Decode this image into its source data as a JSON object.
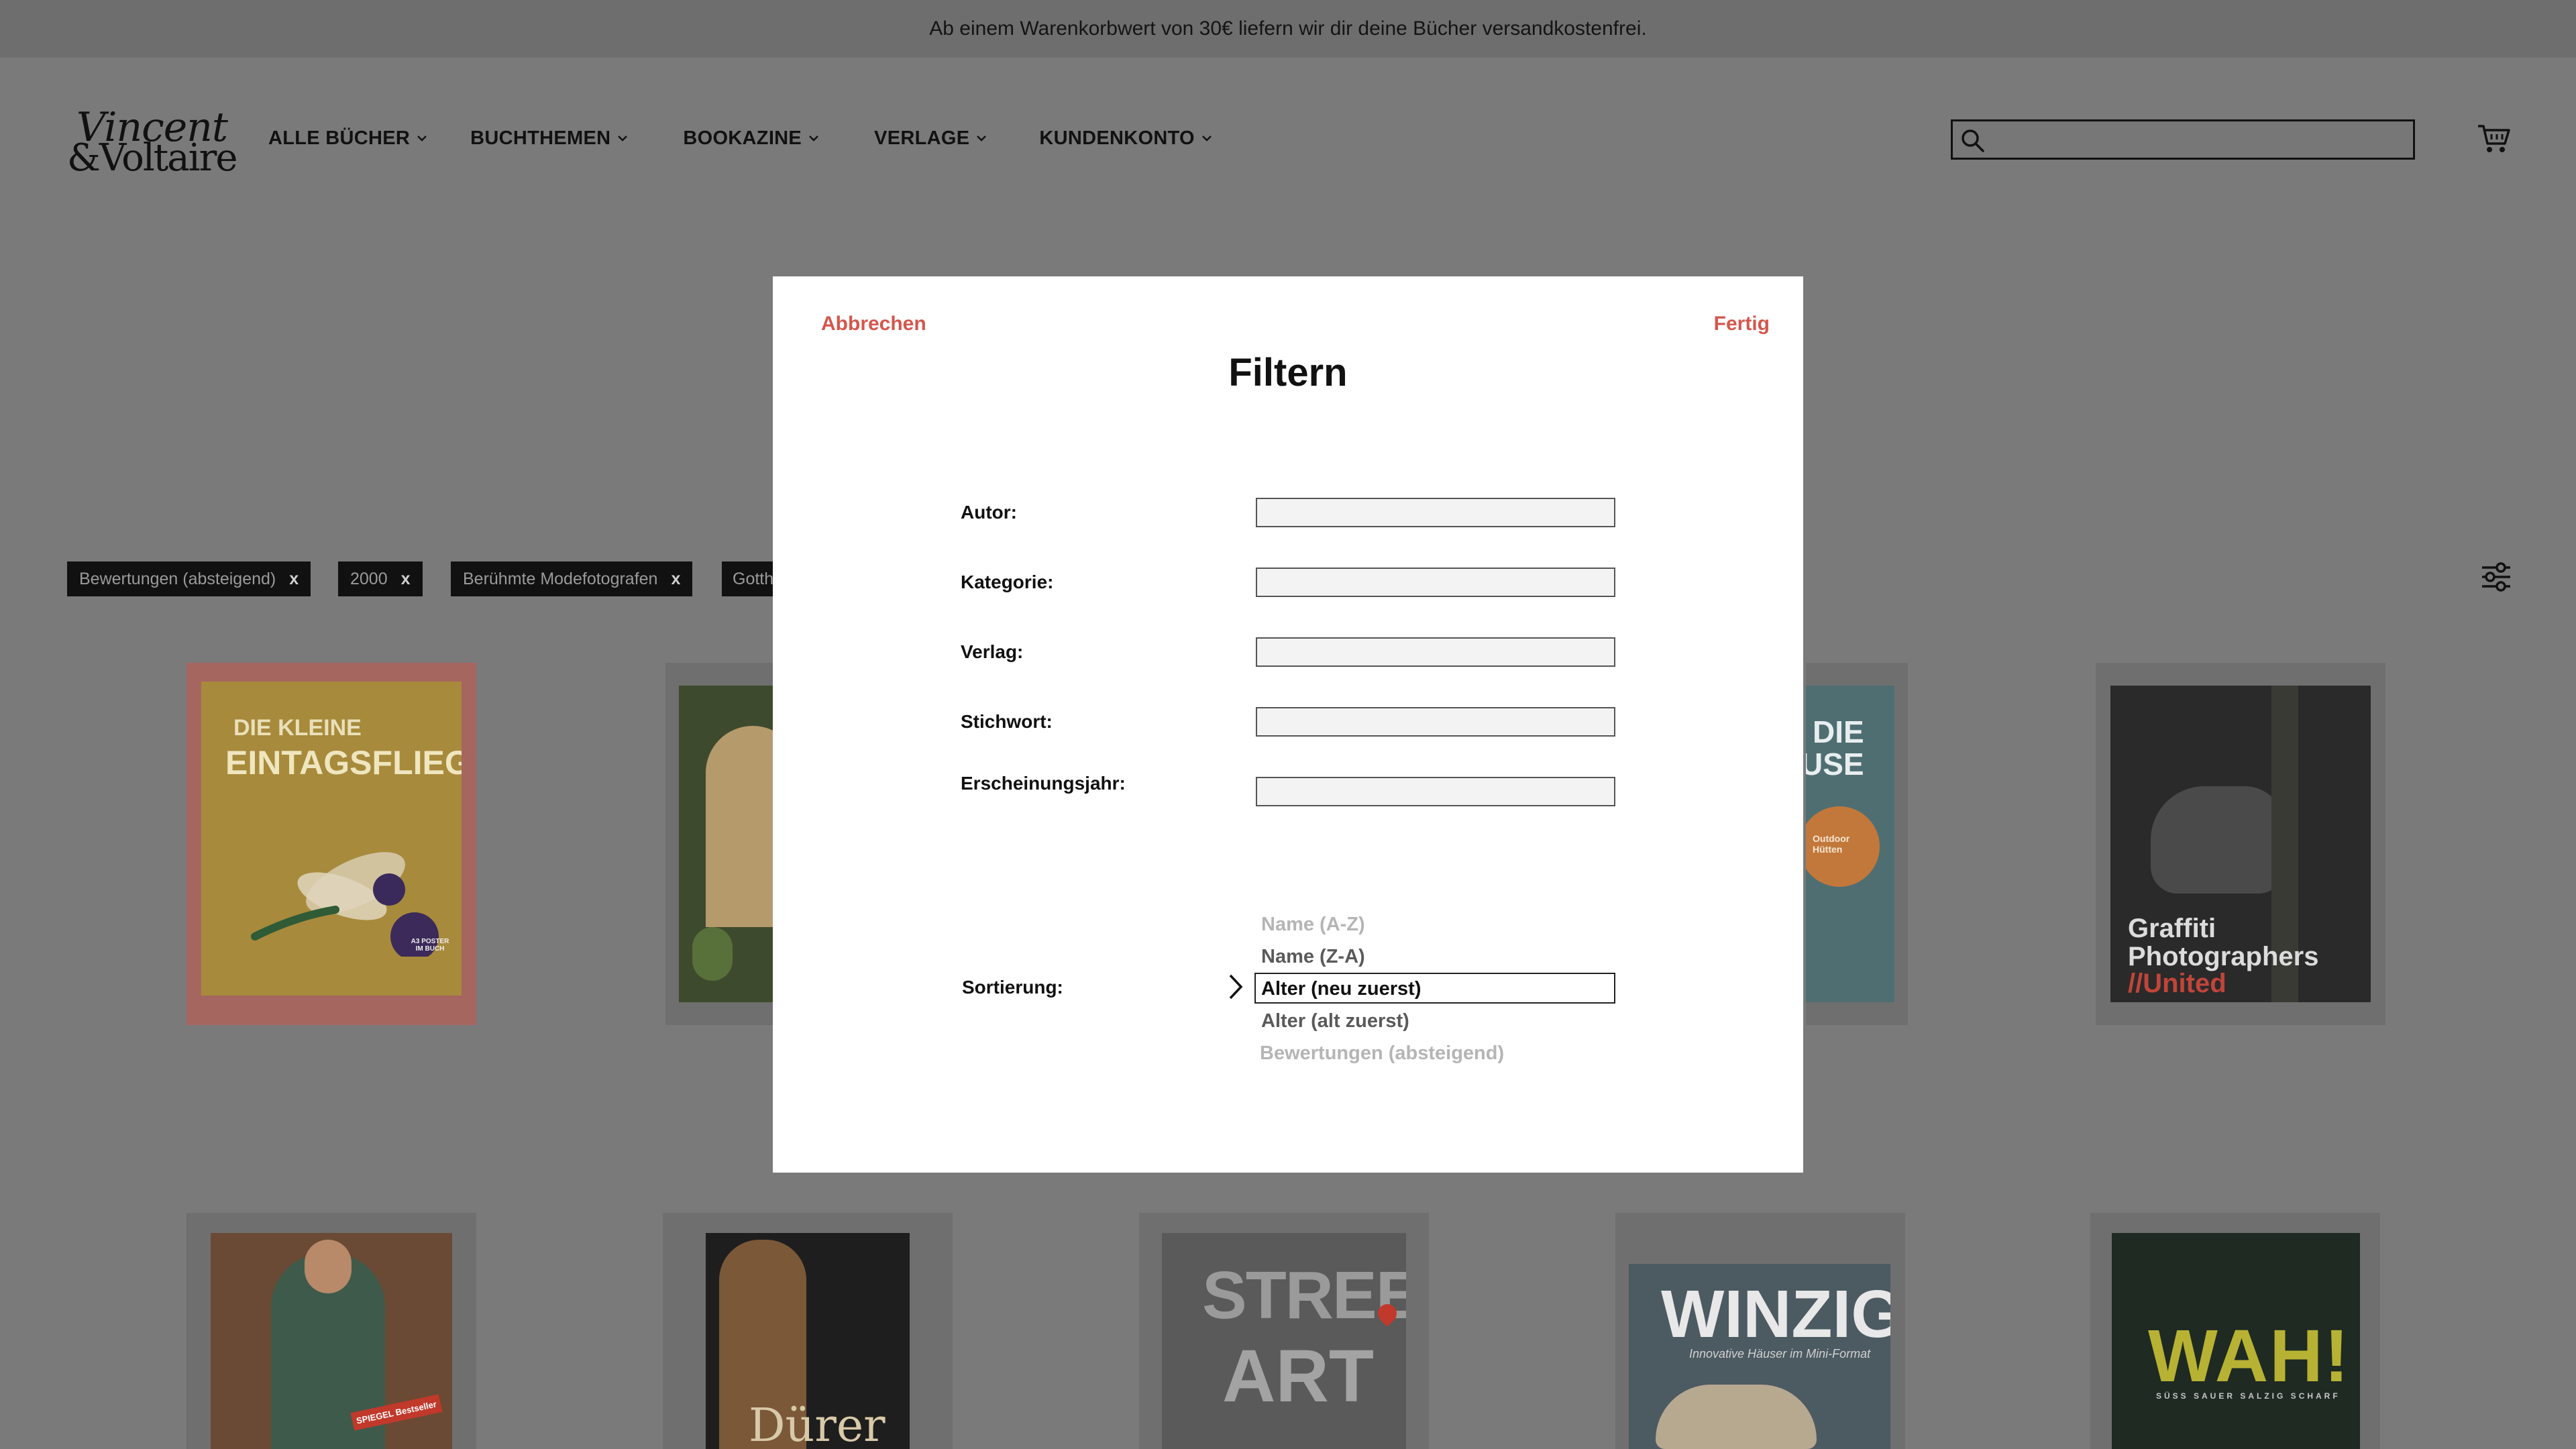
{
  "banner": {
    "text": "Ab einem Warenkorbwert von 30€ liefern wir dir deine Bücher versandkostenfrei."
  },
  "header": {
    "logo_line1": "Vincent",
    "logo_line2": "&Voltaire",
    "nav": [
      {
        "label": "ALLE BÜCHER"
      },
      {
        "label": "BUCHTHEMEN"
      },
      {
        "label": "BOOKAZINE"
      },
      {
        "label": "VERLAGE"
      },
      {
        "label": "KUNDENKONTO"
      }
    ],
    "search": {
      "value": "",
      "icon": "search-icon"
    },
    "cart_icon": "cart-icon"
  },
  "chips": [
    {
      "label": "Bewertungen (absteigend)",
      "remove": "x"
    },
    {
      "label": "2000",
      "remove": "x"
    },
    {
      "label": "Berühmte Modefotografen",
      "remove": "x"
    },
    {
      "label": "Gotth"
    }
  ],
  "books": {
    "row1": [
      {
        "title_line1": "DIE KLEINE",
        "title_line2": "EINTAGSFLIEGE",
        "badge": "A3 POSTER IM BUCH"
      },
      {},
      {
        "title_line1": "DIE",
        "title_line2": "USE",
        "badge": "Outdoor Hütten"
      },
      {
        "title_line1": "Graffiti",
        "title_line2": "Photographers",
        "title_line3": "//United"
      }
    ],
    "row2": [
      {
        "badge": "SPIEGEL Bestseller"
      },
      {
        "title": "Dürer"
      },
      {
        "title_line1": "STREET",
        "title_line2": "ART"
      },
      {
        "title": "WINZIG",
        "subtitle": "Innovative Häuser im Mini-Format"
      },
      {
        "title": "WAH!",
        "tags": "SÜSS SAUER SALZIG SCHARF"
      }
    ]
  },
  "modal": {
    "cancel": "Abbrechen",
    "done": "Fertig",
    "title": "Filtern",
    "fields": [
      {
        "label": "Autor:",
        "value": ""
      },
      {
        "label": "Kategorie:",
        "value": ""
      },
      {
        "label": "Verlag:",
        "value": ""
      },
      {
        "label": "Stichwort:",
        "value": ""
      },
      {
        "label": "Erscheinungsjahr:",
        "value": ""
      }
    ],
    "sort_label": "Sortierung:",
    "sort_options": [
      "Name (A-Z)",
      "Name (Z-A)",
      "Alter (neu zuerst)",
      "Alter (alt zuerst)",
      "Bewertungen (absteigend)"
    ],
    "sort_selected": "Alter (neu zuerst)"
  },
  "colors": {
    "accent": "#d3574d",
    "overlay": "#7a7a7a",
    "chip_bg": "#111111"
  }
}
